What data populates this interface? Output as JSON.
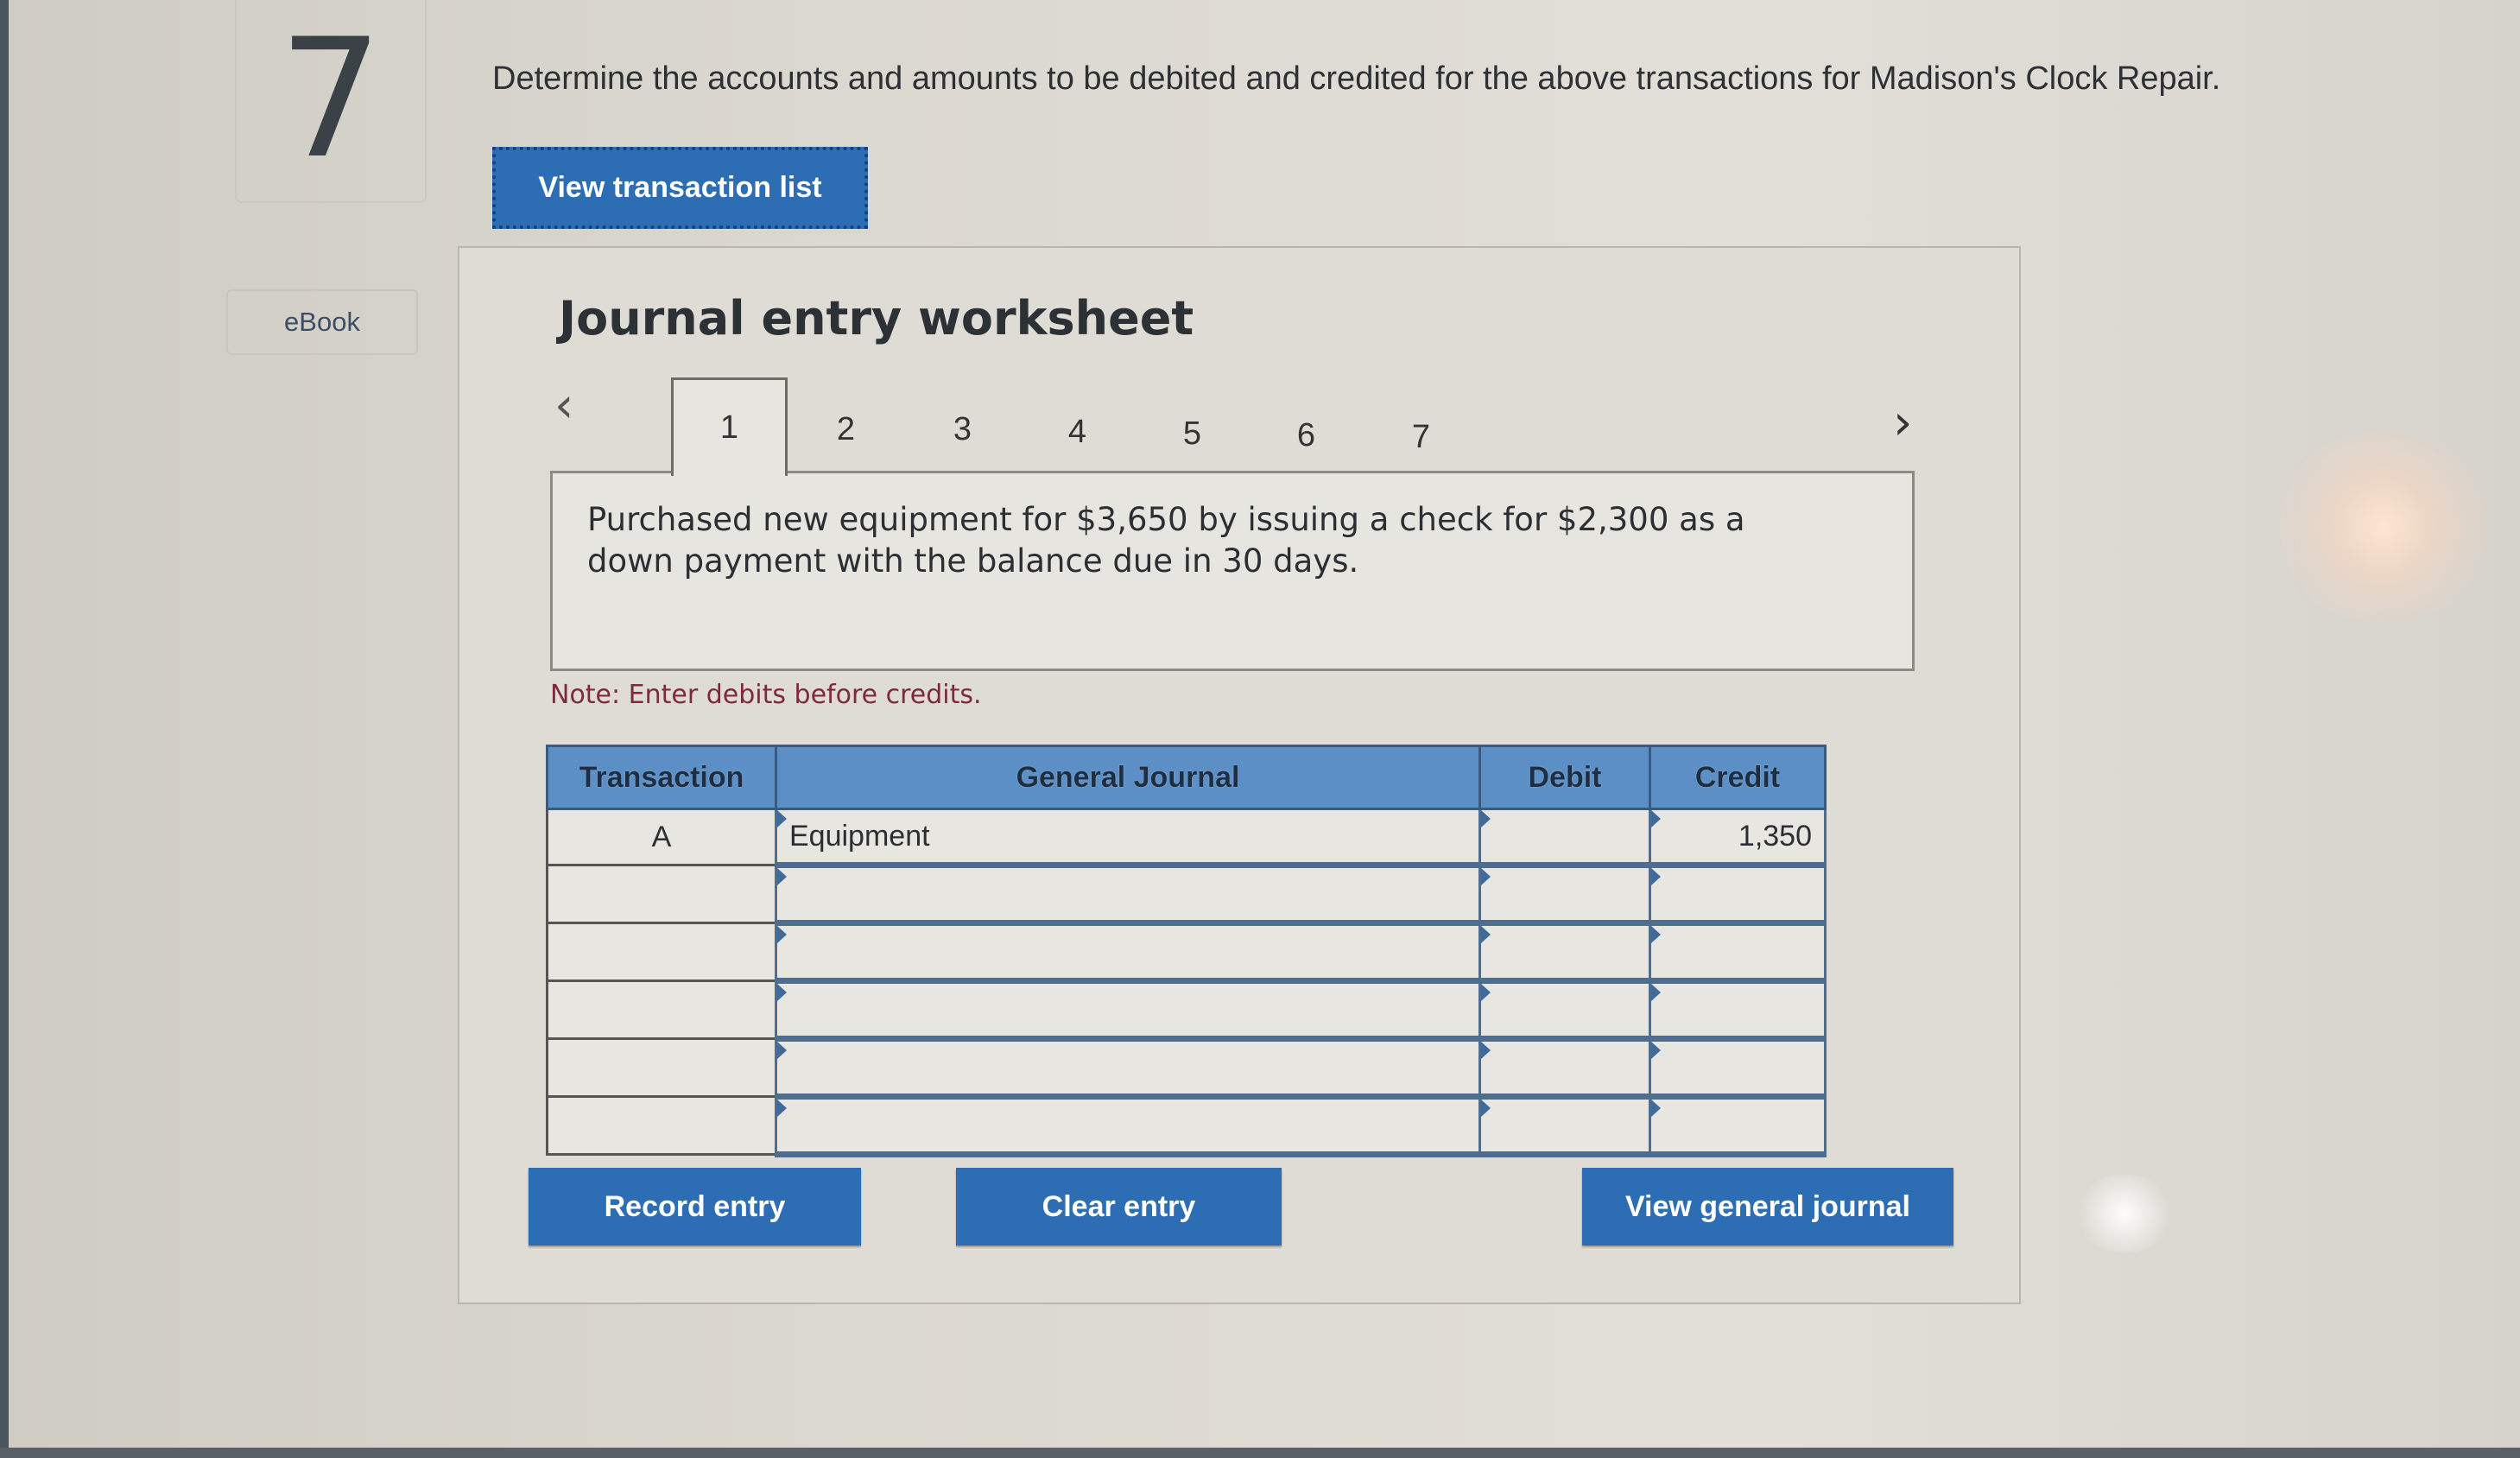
{
  "question": {
    "number": "7",
    "prompt": "Determine the accounts and amounts to be debited and credited for the above transactions for Madison's Clock Repair.",
    "view_transaction_list_label": "View transaction list",
    "ebook_label": "eBook"
  },
  "worksheet": {
    "title": "Journal entry worksheet",
    "prev_icon": "chevron-left-icon",
    "next_icon": "chevron-right-icon",
    "tabs": [
      {
        "label": "1",
        "active": true
      },
      {
        "label": "2",
        "active": false
      },
      {
        "label": "3",
        "active": false
      },
      {
        "label": "4",
        "active": false
      },
      {
        "label": "5",
        "active": false
      },
      {
        "label": "6",
        "active": false
      },
      {
        "label": "7",
        "active": false
      }
    ],
    "description": "Purchased new equipment for $3,650 by issuing a check for $2,300 as a down payment with the balance due in 30 days.",
    "note": "Note: Enter debits before credits.",
    "table": {
      "headers": [
        "Transaction",
        "General Journal",
        "Debit",
        "Credit"
      ],
      "rows": [
        {
          "transaction": "A",
          "account": "Equipment",
          "debit": "",
          "credit": "1,350"
        },
        {
          "transaction": "",
          "account": "",
          "debit": "",
          "credit": ""
        },
        {
          "transaction": "",
          "account": "",
          "debit": "",
          "credit": ""
        },
        {
          "transaction": "",
          "account": "",
          "debit": "",
          "credit": ""
        },
        {
          "transaction": "",
          "account": "",
          "debit": "",
          "credit": ""
        },
        {
          "transaction": "",
          "account": "",
          "debit": "",
          "credit": ""
        }
      ]
    },
    "buttons": {
      "record": "Record entry",
      "clear": "Clear entry",
      "view_journal": "View general journal"
    }
  },
  "colors": {
    "button_blue": "#2d6db3",
    "header_blue": "#5b8fc6",
    "note_red": "#7e2a3b"
  }
}
